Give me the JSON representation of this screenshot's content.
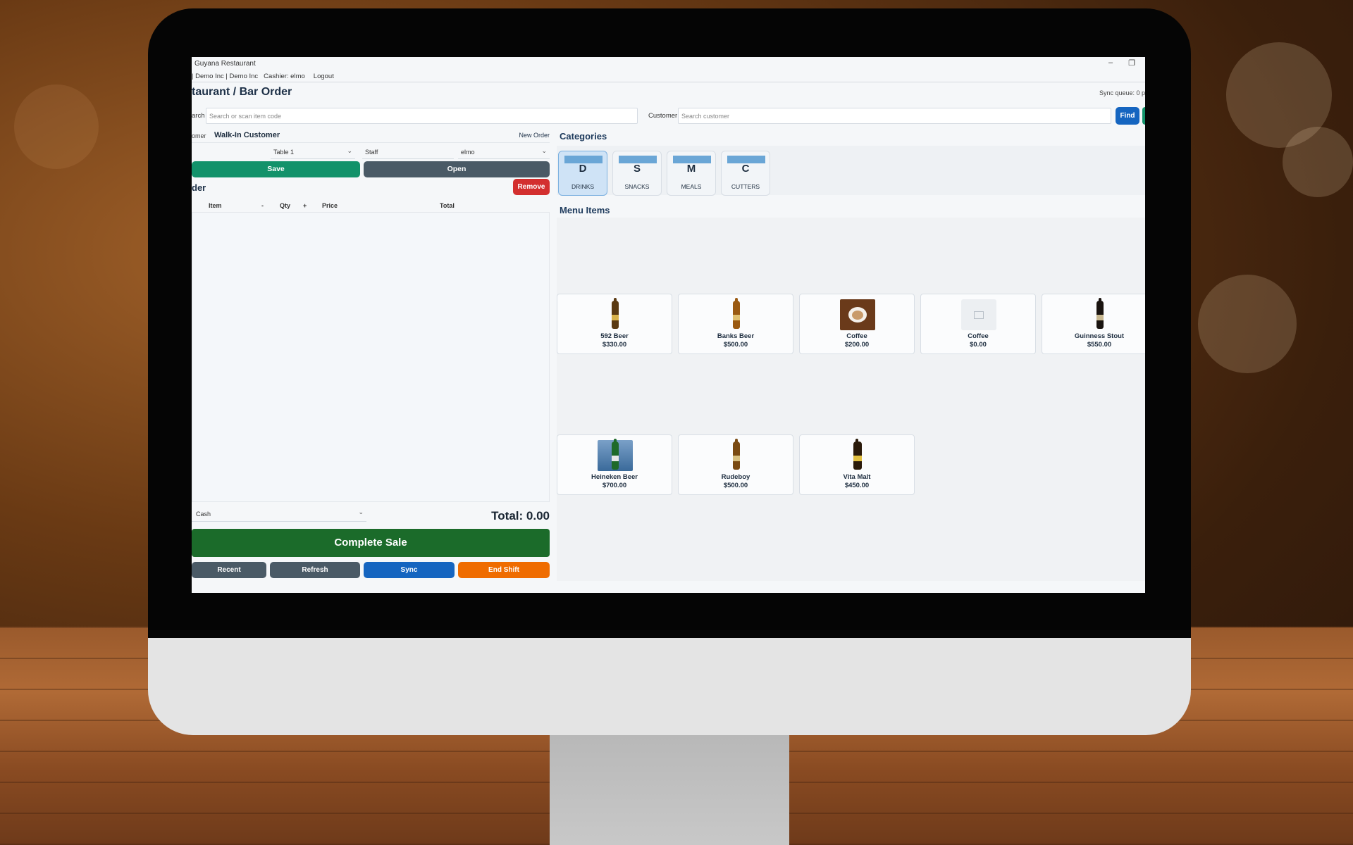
{
  "window": {
    "title": "Guyana Restaurant",
    "minimize_icon": "minimize-icon",
    "restore_icon": "restore-icon"
  },
  "menubar": {
    "company": "| Demo Inc | Demo Inc",
    "cashier": "Cashier: elmo",
    "logout": "Logout"
  },
  "header": {
    "page_title": "taurant / Bar Order",
    "sync_queue": "Sync queue: 0 p"
  },
  "search": {
    "item_label": "arch",
    "item_placeholder": "Search or scan item code",
    "customer_label": "Customer",
    "customer_placeholder": "Search customer",
    "find_label": "Find"
  },
  "order": {
    "customer_label": "omer",
    "customer_name": "Walk-In Customer",
    "new_order": "New Order",
    "table_value": "Table 1",
    "staff_label": "Staff",
    "staff_value": "elmo",
    "save_label": "Save",
    "open_label": "Open",
    "section_title": "der",
    "remove_label": "Remove",
    "columns": [
      "Item",
      "-",
      "Qty",
      "+",
      "Price",
      "Total"
    ],
    "payment_method": "Cash",
    "total": "Total: 0.00",
    "complete_sale": "Complete Sale"
  },
  "footer_buttons": {
    "recent": "Recent",
    "refresh": "Refresh",
    "sync": "Sync",
    "end_shift": "End Shift"
  },
  "categories": {
    "title": "Categories",
    "items": [
      {
        "letter": "D",
        "name": "DRINKS",
        "active": true
      },
      {
        "letter": "S",
        "name": "SNACKS",
        "active": false
      },
      {
        "letter": "M",
        "name": "MEALS",
        "active": false
      },
      {
        "letter": "C",
        "name": "CUTTERS",
        "active": false
      }
    ]
  },
  "menu": {
    "title": "Menu Items",
    "items": [
      {
        "name": "592 Beer",
        "price": "$330.00",
        "icon": "beer-bottle-icon"
      },
      {
        "name": "Banks Beer",
        "price": "$500.00",
        "icon": "beer-bottle-icon"
      },
      {
        "name": "Coffee",
        "price": "$200.00",
        "icon": "coffee-cup-icon"
      },
      {
        "name": "Coffee",
        "price": "$0.00",
        "icon": "image-placeholder-icon"
      },
      {
        "name": "Guinness Stout",
        "price": "$550.00",
        "icon": "beer-bottle-icon"
      },
      {
        "name": "Heineken Beer",
        "price": "$700.00",
        "icon": "beer-photo-icon"
      },
      {
        "name": "Rudeboy",
        "price": "$500.00",
        "icon": "beer-bottle-icon"
      },
      {
        "name": "Vita Malt",
        "price": "$450.00",
        "icon": "malt-bottle-icon"
      }
    ]
  },
  "colors": {
    "save": "#12926a",
    "open": "#4a5a66",
    "remove": "#d32f2f",
    "complete_sale": "#1b6b2a",
    "sync": "#1565c0",
    "end_shift": "#ef6c00",
    "category_accent": "#6aa6d6"
  }
}
